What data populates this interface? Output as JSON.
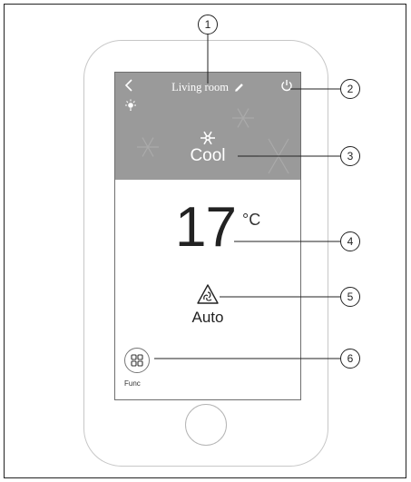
{
  "screen": {
    "header": {
      "back_icon": "chevron-left-icon",
      "room_name": "Living room",
      "edit_icon": "pencil-icon",
      "power_icon": "power-icon",
      "light_icon": "lightbulb-icon",
      "bg_color": "#9a9a9a"
    },
    "mode": {
      "icon": "snowflake-icon",
      "label": "Cool"
    },
    "temperature": {
      "value": "17",
      "unit": "°C"
    },
    "fan": {
      "icon": "fan-speed-icon",
      "label": "Auto"
    },
    "func": {
      "icon": "grid-icon",
      "label": "Func"
    }
  },
  "callouts": [
    "1",
    "2",
    "3",
    "4",
    "5",
    "6"
  ]
}
